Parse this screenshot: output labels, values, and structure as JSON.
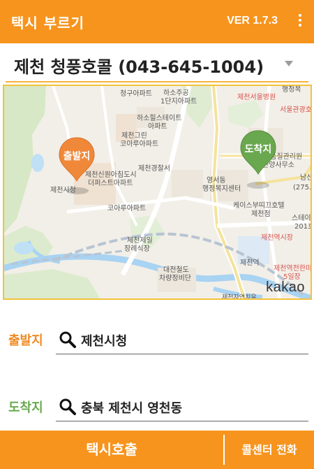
{
  "appbar": {
    "title": "택시 부르기",
    "version": "VER 1.7.3",
    "menu_icon": "more-vert-icon"
  },
  "company": {
    "selected": "제천 청풍호콜 (043-645-1004)"
  },
  "map": {
    "attribution": "kakao",
    "labels": [
      "청구아파트",
      "하소주공",
      "1단지아파트",
      "제천서울병원",
      "서울관광호텔",
      "행정복",
      "하소힐스테이트",
      "아파트",
      "제천그린",
      "코아루아파트",
      "제천경찰서",
      "제천신원아침도시",
      "더퍼스트아파트",
      "제천시청",
      "코아루아파트",
      "영서동",
      "행정복지센터",
      "물품질관리원",
      "단양사무소",
      "남선",
      "(275.1",
      "케이스부띠끄호텔",
      "제천점",
      "스테이",
      "201호",
      "제천제일",
      "장례식장",
      "제천역시장",
      "제천역",
      "제천역전한마",
      "5일장",
      "대전철도",
      "차량정비단",
      "제천자연치유"
    ],
    "start_pin": "출발지",
    "end_pin": "도착지"
  },
  "origin": {
    "label": "출발지",
    "value": "제천시청",
    "icon": "search-icon"
  },
  "destination": {
    "label": "도착지",
    "value": "충북 제천시 영천동",
    "icon": "search-icon"
  },
  "bottom": {
    "call_button": "택시호출",
    "callcenter_button": "콜센터 전화"
  },
  "colors": {
    "primary": "#f7941d",
    "start_pin": "#f0883a",
    "end_pin": "#6aa84f",
    "map_border": "#f3c23a"
  }
}
